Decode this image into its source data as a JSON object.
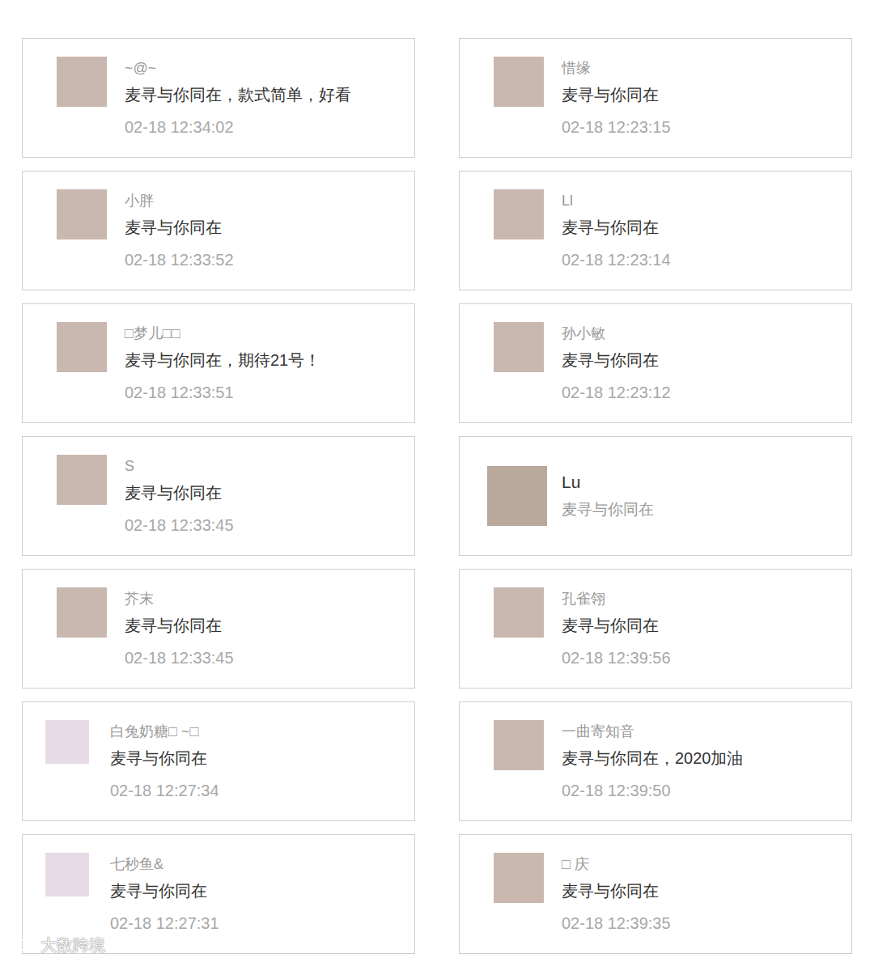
{
  "columns": [
    [
      {
        "kind": "normal",
        "name": "~@~",
        "comment": "麦寻与你同在，款式简单，好看",
        "time": "02-18 12:34:02"
      },
      {
        "kind": "normal",
        "name": "小胖",
        "comment": "麦寻与你同在",
        "time": "02-18 12:33:52"
      },
      {
        "kind": "normal",
        "name": "□梦儿□□",
        "comment": "麦寻与你同在，期待21号！",
        "time": "02-18 12:33:51"
      },
      {
        "kind": "normal",
        "name": "S",
        "comment": "麦寻与你同在",
        "time": "02-18 12:33:45"
      },
      {
        "kind": "normal",
        "name": "芥末",
        "comment": "麦寻与你同在",
        "time": "02-18 12:33:45"
      },
      {
        "kind": "compact",
        "name": "白兔奶糖□ ~□",
        "comment": "麦寻与你同在",
        "time": "02-18 12:27:34"
      },
      {
        "kind": "compact",
        "name": "七秒鱼&",
        "comment": "麦寻与你同在",
        "time": "02-18 12:27:31"
      }
    ],
    [
      {
        "kind": "normal",
        "name": "惜缘",
        "comment": "麦寻与你同在",
        "time": "02-18 12:23:15"
      },
      {
        "kind": "normal",
        "name": "Ll",
        "comment": "麦寻与你同在",
        "time": "02-18 12:23:14"
      },
      {
        "kind": "normal",
        "name": "孙小敏",
        "comment": "麦寻与你同在",
        "time": "02-18 12:23:12"
      },
      {
        "kind": "no-time",
        "name": "Lu",
        "comment": "麦寻与你同在"
      },
      {
        "kind": "normal",
        "name": "孔雀翎",
        "comment": "麦寻与你同在",
        "time": "02-18 12:39:56"
      },
      {
        "kind": "normal",
        "name": "一曲寄知音",
        "comment": "麦寻与你同在，2020加油",
        "time": "02-18 12:39:50"
      },
      {
        "kind": "normal",
        "name": "□ 庆",
        "comment": "麦寻与你同在",
        "time": "02-18 12:39:35"
      }
    ]
  ],
  "watermark": "大数跨境"
}
